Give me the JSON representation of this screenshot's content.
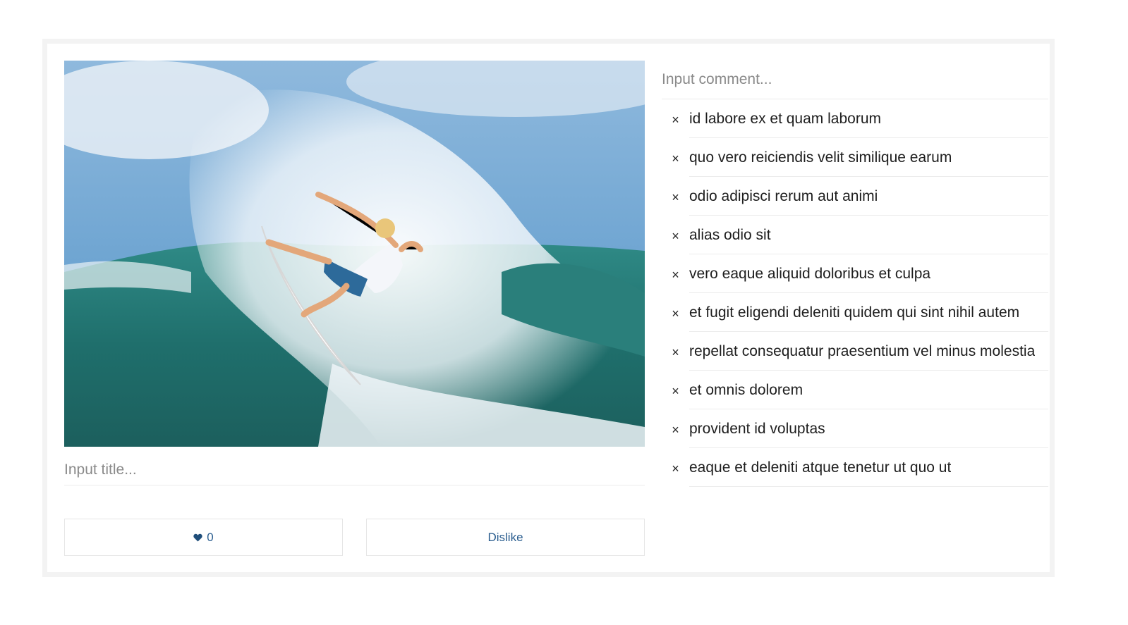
{
  "post": {
    "image_alt": "Surfer riding a wave",
    "title_placeholder": "Input title...",
    "title_value": ""
  },
  "actions": {
    "like_icon": "heart-icon",
    "like_count": "0",
    "dislike_label": "Dislike",
    "accent_color": "#2a5d8f"
  },
  "comments": {
    "input_placeholder": "Input comment...",
    "remove_glyph": "×",
    "items": [
      {
        "text": "id labore ex et quam laborum"
      },
      {
        "text": "quo vero reiciendis velit similique earum"
      },
      {
        "text": "odio adipisci rerum aut animi"
      },
      {
        "text": "alias odio sit"
      },
      {
        "text": "vero eaque aliquid doloribus et culpa"
      },
      {
        "text": "et fugit eligendi deleniti quidem qui sint nihil autem"
      },
      {
        "text": "repellat consequatur praesentium vel minus molestia"
      },
      {
        "text": "et omnis dolorem"
      },
      {
        "text": "provident id voluptas"
      },
      {
        "text": "eaque et deleniti atque tenetur ut quo ut"
      }
    ]
  }
}
